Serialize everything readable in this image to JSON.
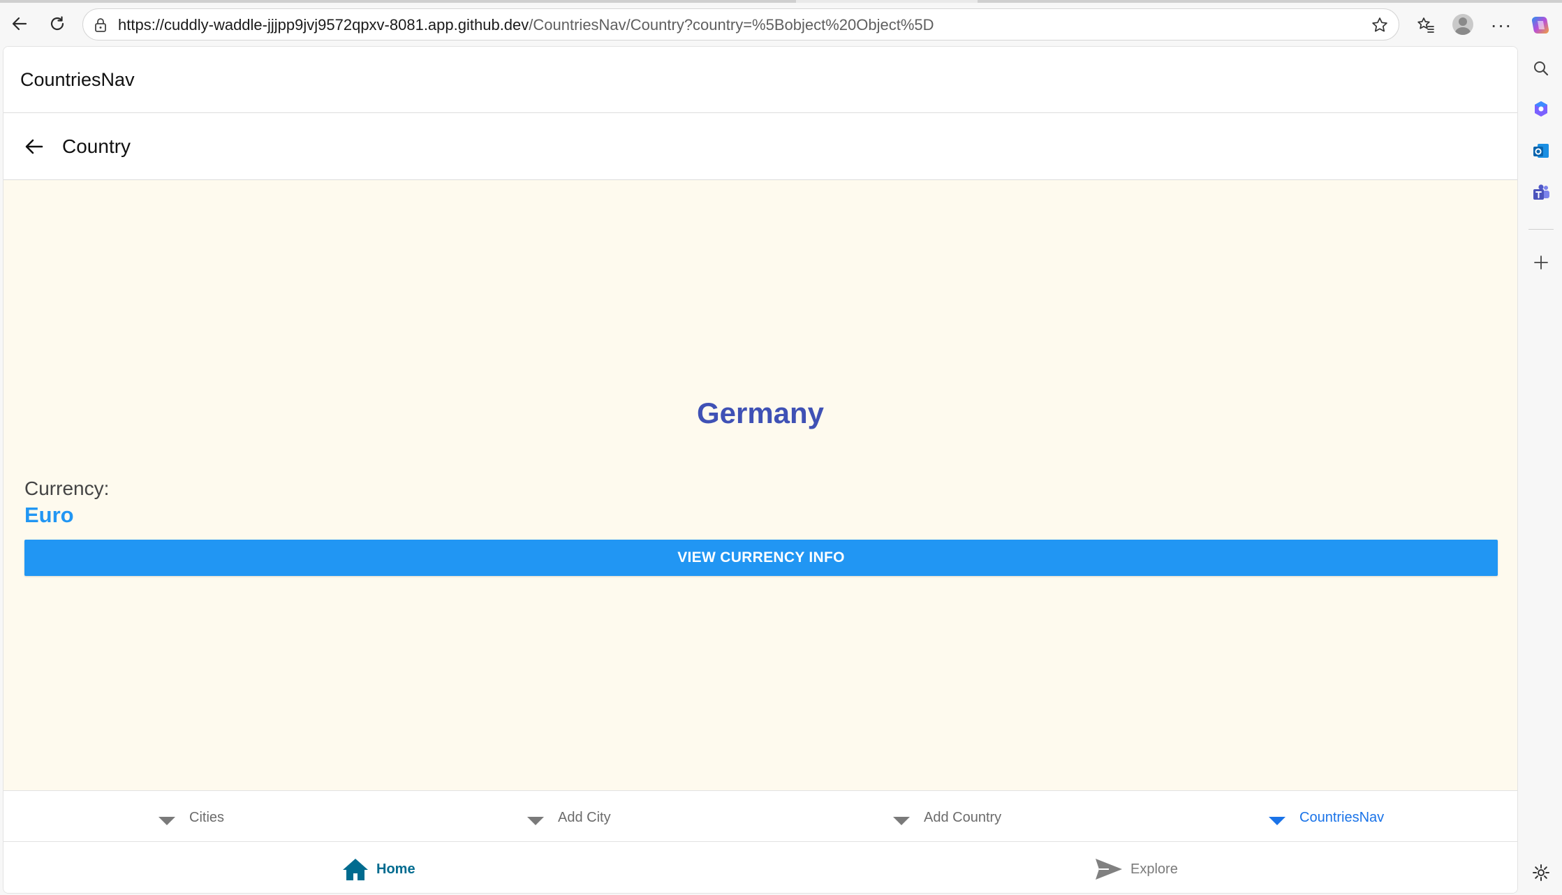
{
  "browser": {
    "url_host": "https://cuddly-waddle-jjjpp9jvj9572qpxv-8081.app.github.dev",
    "url_path": "/CountriesNav/Country?country=%5Bobject%20Object%5D",
    "icons": {
      "back": "arrow-left-icon",
      "reload": "reload-icon",
      "lock": "lock-icon",
      "favorite": "star-icon",
      "favorites": "favorites-icon",
      "profile": "avatar",
      "more": "more-icon"
    }
  },
  "sidebar": {
    "items": [
      "search-icon",
      "copilot-icon",
      "outlook-icon",
      "teams-icon",
      "add-icon",
      "settings-icon"
    ]
  },
  "app": {
    "title": "CountriesNav",
    "page_title": "Country",
    "country": "Germany",
    "currency_label": "Currency:",
    "currency_value": "Euro",
    "currency_button": "VIEW CURRENCY INFO",
    "colors": {
      "country": "#3f51b5",
      "accent": "#2196f3",
      "content_bg": "#fefaee",
      "active_tab": "#1a73e8",
      "home": "#006b8f"
    }
  },
  "top_tabs": [
    {
      "label": "Cities",
      "active": false
    },
    {
      "label": "Add City",
      "active": false
    },
    {
      "label": "Add Country",
      "active": false
    },
    {
      "label": "CountriesNav",
      "active": true
    }
  ],
  "bottom_tabs": [
    {
      "label": "Home",
      "icon": "home-icon",
      "active": true
    },
    {
      "label": "Explore",
      "icon": "send-icon",
      "active": false
    }
  ]
}
